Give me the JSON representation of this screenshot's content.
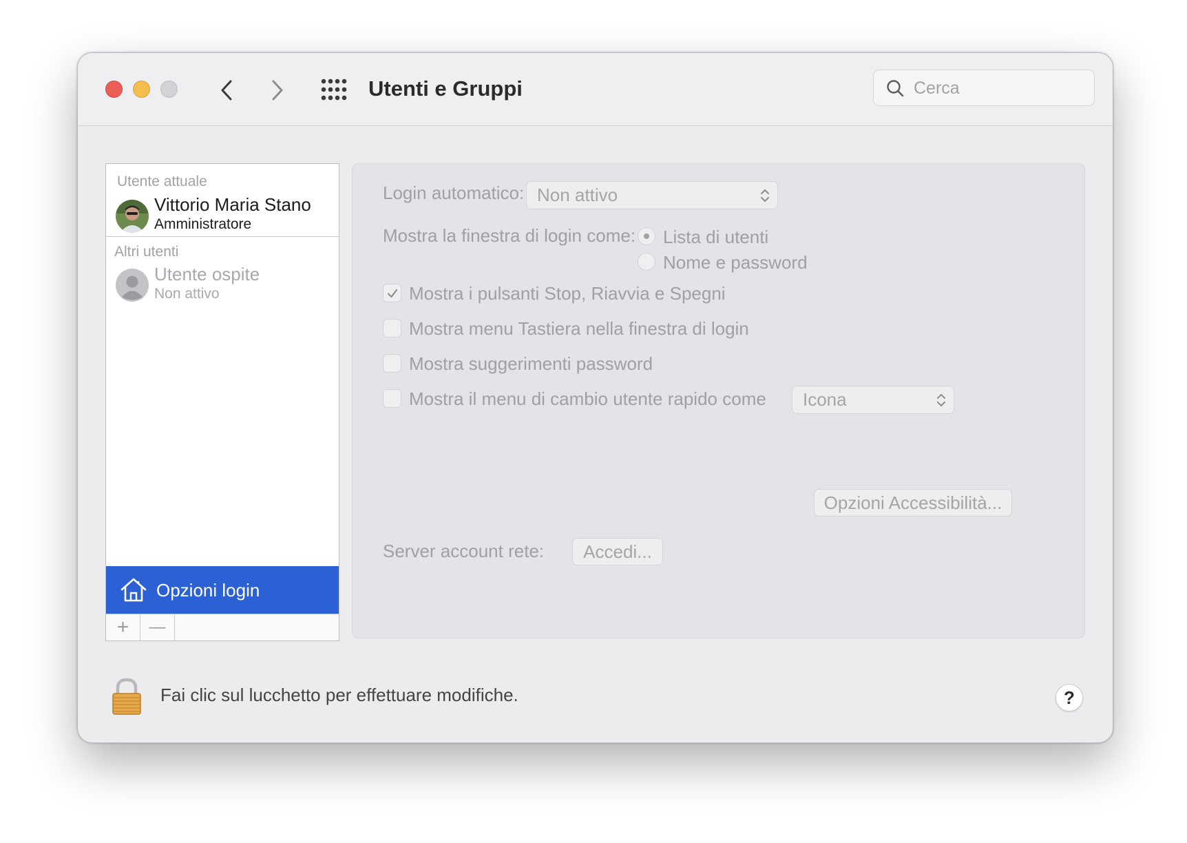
{
  "window": {
    "title": "Utenti e Gruppi",
    "search_placeholder": "Cerca"
  },
  "sidebar": {
    "current_user_header": "Utente attuale",
    "current_user": {
      "name": "Vittorio Maria Stano",
      "role": "Amministratore"
    },
    "other_users_header": "Altri utenti",
    "guest_user": {
      "name": "Utente ospite",
      "status": "Non attivo"
    },
    "login_options_label": "Opzioni login",
    "add_label": "+",
    "remove_label": "—"
  },
  "login_options": {
    "auto_login_label": "Login automatico:",
    "auto_login_value": "Non attivo",
    "login_window_label": "Mostra la finestra di login come:",
    "login_window_options": [
      {
        "label": "Lista di utenti",
        "selected": true
      },
      {
        "label": "Nome e password",
        "selected": false
      }
    ],
    "checkboxes": [
      {
        "label": "Mostra i pulsanti Stop, Riavvia e Spegni",
        "checked": true
      },
      {
        "label": "Mostra menu Tastiera nella finestra di login",
        "checked": false
      },
      {
        "label": "Mostra suggerimenti password",
        "checked": false
      },
      {
        "label": "Mostra il menu di cambio utente rapido come",
        "checked": false
      }
    ],
    "fast_switch_value": "Icona",
    "accessibility_button": "Opzioni Accessibilità...",
    "network_server_label": "Server account rete:",
    "join_button": "Accedi..."
  },
  "footer": {
    "lock_text": "Fai clic sul lucchetto per effettuare modifiche.",
    "help_label": "?"
  },
  "colors": {
    "selection_blue": "#2c61d6",
    "close_red": "#ec5f57",
    "minimize_yellow": "#f4be4f"
  },
  "icons": [
    "back-chevron-icon",
    "forward-chevron-icon",
    "grid-icon",
    "search-icon",
    "house-icon",
    "lock-icon",
    "checkmark-icon",
    "updown-chevron-icon"
  ]
}
